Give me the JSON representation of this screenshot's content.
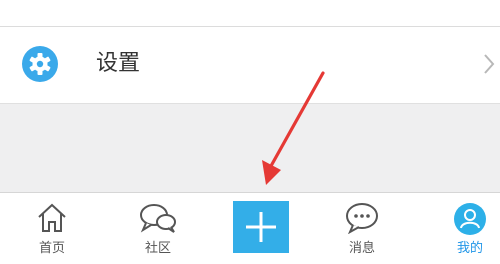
{
  "settings": {
    "label": "设置",
    "icon": "gear-icon",
    "chevron": "chevron-right-icon"
  },
  "tabs": [
    {
      "label": "首页",
      "icon": "home-icon",
      "active": false
    },
    {
      "label": "社区",
      "icon": "chat-bubbles-icon",
      "active": false
    },
    {
      "label": "",
      "icon": "plus-icon",
      "active": false
    },
    {
      "label": "消息",
      "icon": "message-icon",
      "active": false
    },
    {
      "label": "我的",
      "icon": "profile-icon",
      "active": true
    }
  ],
  "colors": {
    "accent": "#33aee8",
    "active_tab_text": "#2196e8",
    "background": "#efeff0",
    "annotation_arrow": "#e53935"
  }
}
